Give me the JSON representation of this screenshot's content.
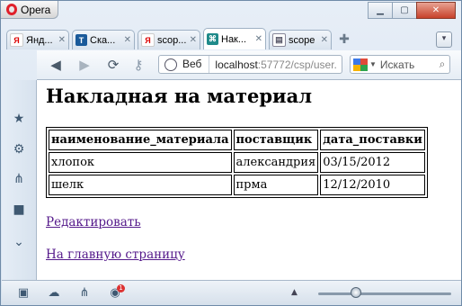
{
  "app": {
    "name": "Opera"
  },
  "tabs": [
    {
      "label": "Янд...",
      "icon": "yandex-icon",
      "color": "#ffffff",
      "text": "Я"
    },
    {
      "label": "Ска...",
      "icon": "T-icon",
      "color": "#1a5a9a",
      "text": "T"
    },
    {
      "label": "scop...",
      "icon": "yandex-icon",
      "color": "#ffffff",
      "text": "Я"
    },
    {
      "label": "Нак...",
      "icon": "network-icon",
      "color": "#1f8a8a",
      "text": "⌘"
    },
    {
      "label": "scope (...",
      "icon": "page-icon",
      "color": "#ffffff",
      "text": "▤"
    }
  ],
  "toolbar": {
    "web_label": "Веб",
    "url_host": "localhost",
    "url_rest": ":57772/csp/user.",
    "search_placeholder": "Искать"
  },
  "page": {
    "title": "Накладная на материал",
    "table": {
      "headers": [
        "наименование_материала",
        "поставщик",
        "дата_поставки"
      ],
      "rows": [
        [
          "хлопок",
          "александрия",
          "03/15/2012"
        ],
        [
          "шелк",
          "прма",
          "12/12/2010"
        ]
      ]
    },
    "links": {
      "edit": "Редактировать",
      "home": "На главную страницу"
    }
  },
  "status": {
    "zoom_percent": 100,
    "notification_count": "1"
  }
}
